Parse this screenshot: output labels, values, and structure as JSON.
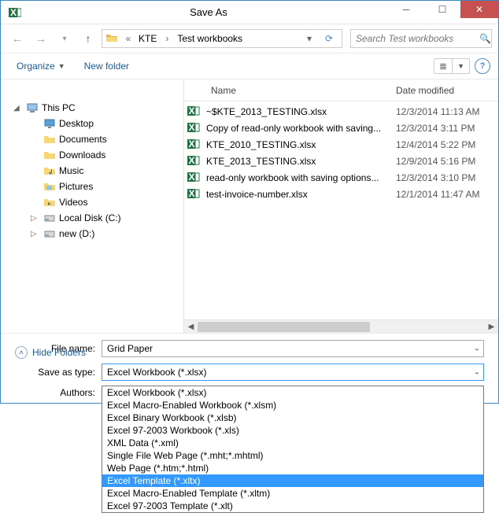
{
  "window": {
    "title": "Save As"
  },
  "breadcrumbs": {
    "sep1": "«",
    "part1": "KTE",
    "arrow": "›",
    "part2": "Test workbooks"
  },
  "search": {
    "placeholder": "Search Test workbooks"
  },
  "toolbar": {
    "organize": "Organize",
    "new_folder": "New folder"
  },
  "columns": {
    "name": "Name",
    "date": "Date modified"
  },
  "sidebar": {
    "root_label": "This PC",
    "items": [
      {
        "label": "Desktop"
      },
      {
        "label": "Documents"
      },
      {
        "label": "Downloads"
      },
      {
        "label": "Music"
      },
      {
        "label": "Pictures"
      },
      {
        "label": "Videos"
      },
      {
        "label": "Local Disk (C:)"
      },
      {
        "label": "new (D:)"
      }
    ]
  },
  "files": [
    {
      "name": "~$KTE_2013_TESTING.xlsx",
      "date": "12/3/2014 11:13 AM"
    },
    {
      "name": "Copy of read-only workbook with saving...",
      "date": "12/3/2014 3:11 PM"
    },
    {
      "name": "KTE_2010_TESTING.xlsx",
      "date": "12/4/2014 5:22 PM"
    },
    {
      "name": "KTE_2013_TESTING.xlsx",
      "date": "12/9/2014 5:16 PM"
    },
    {
      "name": "read-only workbook with saving options...",
      "date": "12/3/2014 3:10 PM"
    },
    {
      "name": "test-invoice-number.xlsx",
      "date": "12/1/2014 11:47 AM"
    }
  ],
  "form": {
    "filename_label": "File name:",
    "filename_value": "Grid Paper",
    "type_label": "Save as type:",
    "type_value": "Excel Workbook (*.xlsx)",
    "authors_label": "Authors:",
    "hide_folders": "Hide Folders"
  },
  "type_options": [
    "Excel Workbook (*.xlsx)",
    "Excel Macro-Enabled Workbook (*.xlsm)",
    "Excel Binary Workbook (*.xlsb)",
    "Excel 97-2003 Workbook (*.xls)",
    "XML Data (*.xml)",
    "Single File Web Page (*.mht;*.mhtml)",
    "Web Page (*.htm;*.html)",
    "Excel Template (*.xltx)",
    "Excel Macro-Enabled Template (*.xltm)",
    "Excel 97-2003 Template (*.xlt)"
  ],
  "type_selected_index": 7
}
